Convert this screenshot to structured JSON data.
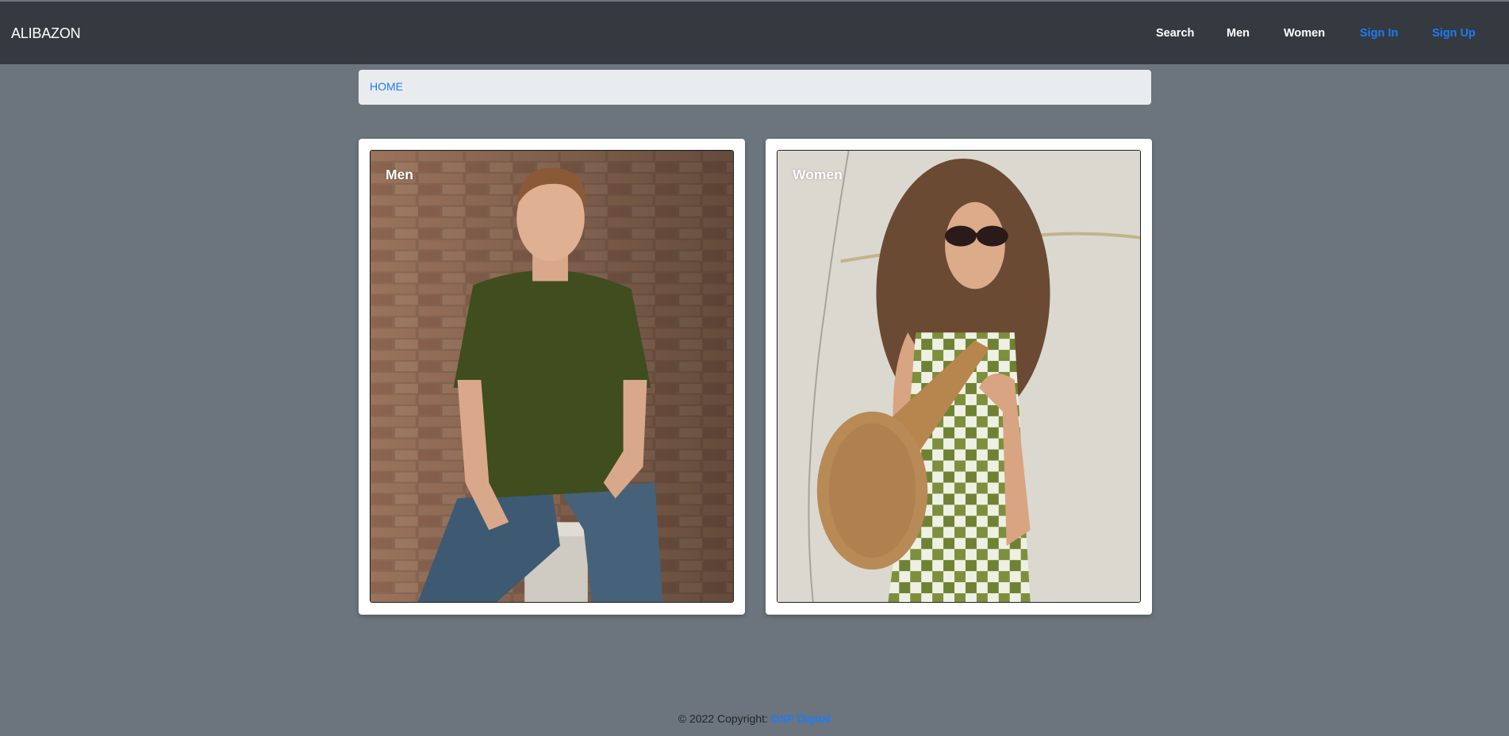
{
  "brand": "ALIBAZON",
  "nav": {
    "search": "Search",
    "men": "Men",
    "women": "Women",
    "sign_in": "Sign In",
    "sign_up": "Sign Up"
  },
  "breadcrumb": {
    "home": "HOME"
  },
  "cards": [
    {
      "title": "Men",
      "image": "man in olive t-shirt and jeans sitting on stool against brick wall"
    },
    {
      "title": "Women",
      "image": "woman with curly hair, sunglasses, green checkered dress and woven bag"
    }
  ],
  "footer": {
    "copyright": "© 2022 Copyright:",
    "company": "OSF Digital"
  },
  "colors": {
    "navbar": "#343a40",
    "page_bg": "#6c757d",
    "link_blue": "#1e7bf5",
    "breadcrumb_bg": "#e9ecef"
  }
}
